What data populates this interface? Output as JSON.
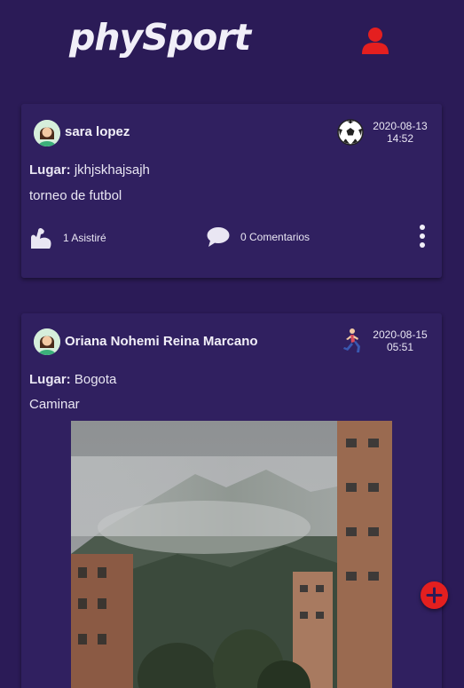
{
  "app": {
    "logo_text": "phySport",
    "accent_color": "#e41f1f",
    "background_color": "#2b1b57"
  },
  "header": {
    "profile_icon": "user-icon"
  },
  "posts": [
    {
      "user_name": "sara lopez",
      "avatar_icon": "woman-avatar-icon",
      "sport_icon": "soccer-ball-icon",
      "date": "2020-08-13",
      "time": "14:52",
      "lugar_label": "Lugar:",
      "lugar_value": "jkhjskhajsajh",
      "description": "torneo de futbol",
      "attend_icon": "flexed-arm-icon",
      "attend_label": "1 Asistiré",
      "comments_icon": "speech-bubble-icon",
      "comments_label": "0 Comentarios",
      "menu_icon": "more-vertical-icon"
    },
    {
      "user_name": "Oriana Nohemi Reina Marcano",
      "avatar_icon": "woman-avatar-icon",
      "sport_icon": "running-person-icon",
      "date": "2020-08-15",
      "time": "05:51",
      "lugar_label": "Lugar:",
      "lugar_value": "Bogota",
      "description": "Caminar",
      "image_alt": "foggy mountains and buildings photo"
    }
  ],
  "fab": {
    "icon": "plus-icon"
  }
}
